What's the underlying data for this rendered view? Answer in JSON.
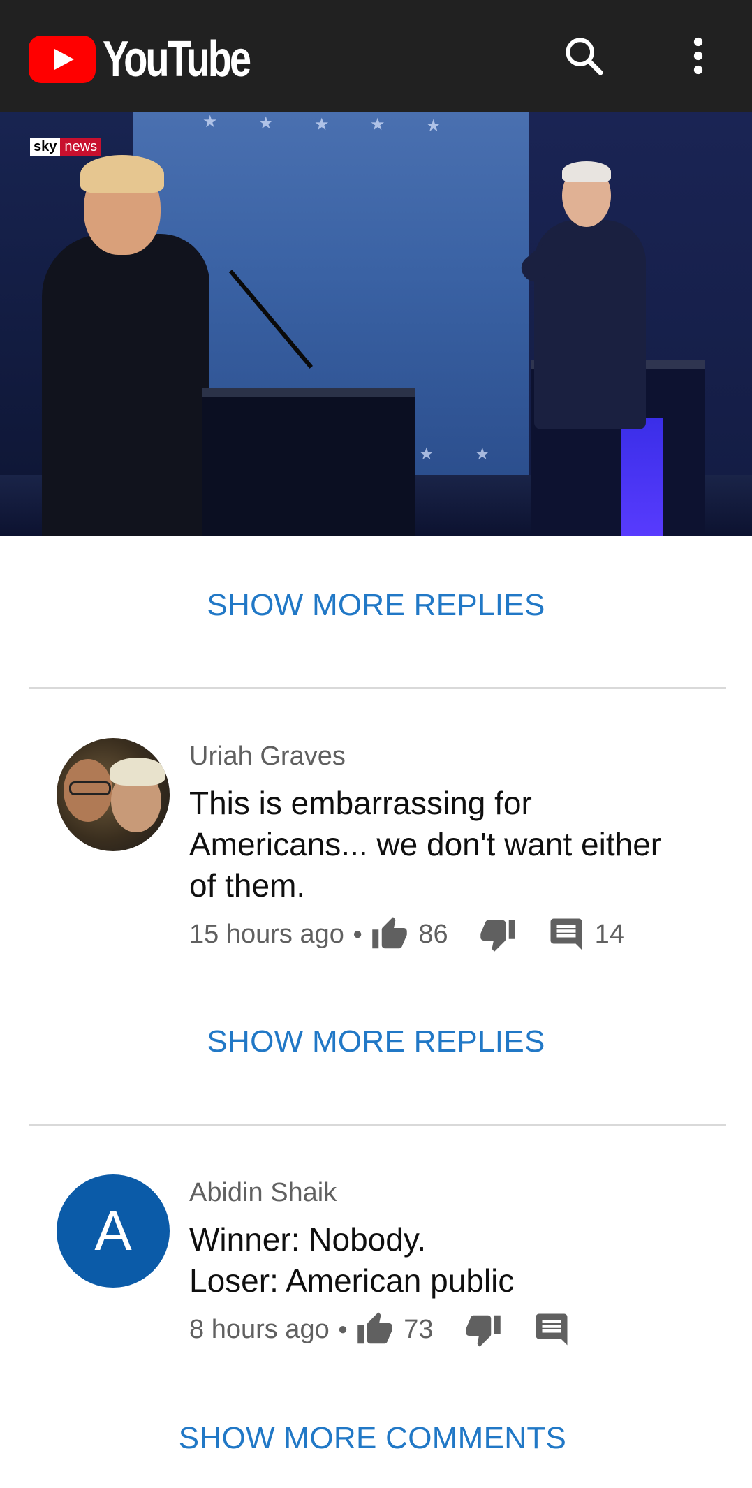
{
  "header": {
    "app_name": "YouTube",
    "icons": [
      "youtube-play-icon",
      "search-icon",
      "more-vert-icon"
    ]
  },
  "video": {
    "channel_badge": {
      "left": "sky",
      "right": "news"
    }
  },
  "replies": {
    "show_more_label": "SHOW MORE REPLIES"
  },
  "comments": [
    {
      "author": "Uriah Graves",
      "text": "This is embarrassing for\nAmericans... we don't want either\nof them.",
      "time": "15 hours ago",
      "likes": "86",
      "replies": "14",
      "avatar": "photo"
    },
    {
      "author": "Abidin Shaik",
      "text": "Winner: Nobody.\nLoser: American public",
      "time": "8 hours ago",
      "likes": "73",
      "replies": "",
      "avatar_letter": "A",
      "avatar_color": "#0b5ba8"
    }
  ],
  "footer": {
    "show_more_comments_label": "SHOW MORE COMMENTS"
  },
  "colors": {
    "accent_link": "#2178c6",
    "header_bg": "#212121",
    "brand_red": "#ff0000"
  }
}
